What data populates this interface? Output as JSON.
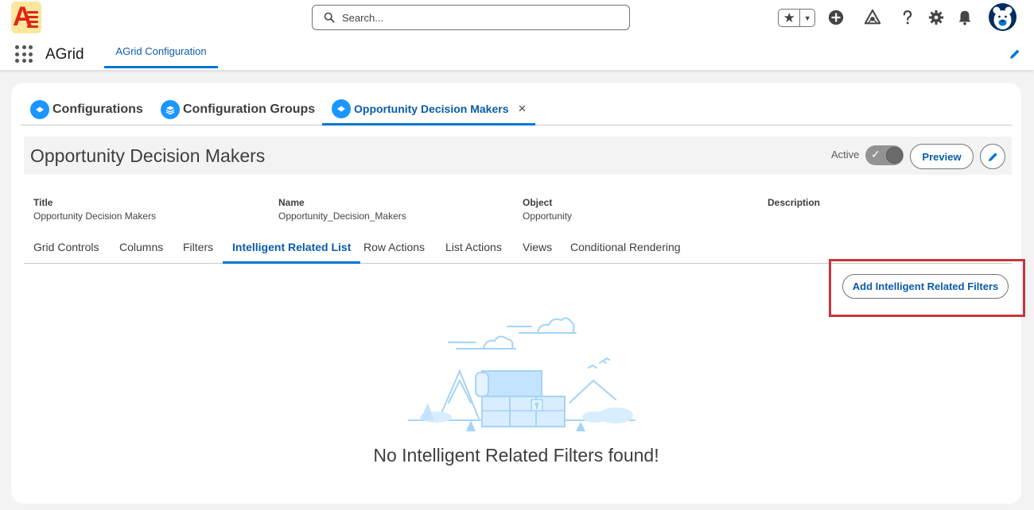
{
  "header": {
    "search_placeholder": "Search...",
    "icons": [
      "favorites-star-icon",
      "add-icon",
      "trailhead-icon",
      "help-icon",
      "setup-gear-icon",
      "notifications-bell-icon"
    ]
  },
  "app_nav": {
    "app_name": "AGrid",
    "active_tab": "AGrid Configuration"
  },
  "workspace_tabs": [
    {
      "label": "Configurations",
      "icon": "configuration-icon"
    },
    {
      "label": "Configuration Groups",
      "icon": "layers-icon"
    },
    {
      "label": "Opportunity Decision Makers",
      "icon": "configuration-icon",
      "closable": "×"
    }
  ],
  "record": {
    "title": "Opportunity Decision Makers",
    "active_label": "Active",
    "preview_label": "Preview",
    "fields": [
      {
        "label": "Title",
        "value": "Opportunity Decision Makers"
      },
      {
        "label": "Name",
        "value": "Opportunity_Decision_Makers"
      },
      {
        "label": "Object",
        "value": "Opportunity"
      },
      {
        "label": "Description",
        "value": ""
      }
    ]
  },
  "sub_tabs": {
    "items": [
      "Grid Controls",
      "Columns",
      "Filters",
      "Intelligent Related List",
      "Row Actions",
      "List Actions",
      "Views",
      "Conditional Rendering"
    ],
    "selected": "Intelligent Related List"
  },
  "panel": {
    "add_button_label": "Add Intelligent Related Filters",
    "empty_message": "No Intelligent Related Filters found!"
  },
  "colors": {
    "brand_blue": "#0176d3",
    "link_blue": "#0b5cab",
    "highlight_red": "#c9363c",
    "logo_yellow": "#fde79b"
  }
}
